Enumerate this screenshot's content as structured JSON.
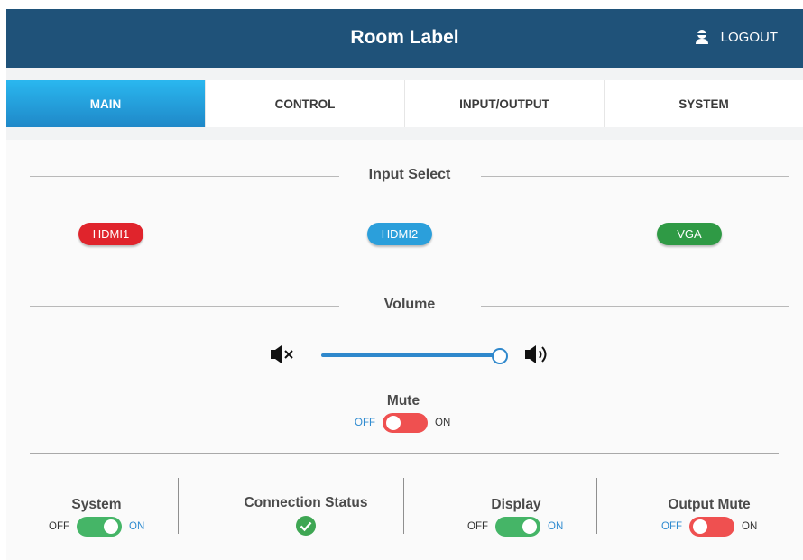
{
  "header": {
    "title": "Room Label",
    "logout_label": "LOGOUT"
  },
  "tabs": [
    {
      "label": "MAIN",
      "active": true
    },
    {
      "label": "CONTROL",
      "active": false
    },
    {
      "label": "INPUT/OUTPUT",
      "active": false
    },
    {
      "label": "SYSTEM",
      "active": false
    }
  ],
  "input_select": {
    "title": "Input Select",
    "inputs": [
      {
        "label": "HDMI1",
        "color": "#e0242c"
      },
      {
        "label": "HDMI2",
        "color": "#2b9fdb"
      },
      {
        "label": "VGA",
        "color": "#2f9a45"
      }
    ]
  },
  "volume": {
    "title": "Volume",
    "level": 1.0
  },
  "mute": {
    "title": "Mute",
    "off_label": "OFF",
    "on_label": "ON",
    "state": "on",
    "color": "#ef5050"
  },
  "status": {
    "system": {
      "title": "System",
      "off_label": "OFF",
      "on_label": "ON",
      "state": "on",
      "color": "#45b567"
    },
    "connection": {
      "title": "Connection Status",
      "icon": "check-circle-icon",
      "color": "#3ea653"
    },
    "display": {
      "title": "Display",
      "off_label": "OFF",
      "on_label": "ON",
      "state": "on",
      "color": "#45b567"
    },
    "output_mute": {
      "title": "Output Mute",
      "off_label": "OFF",
      "on_label": "ON",
      "state": "off",
      "color": "#ef5050"
    }
  },
  "colors": {
    "header": "#1f5279",
    "accent": "#2f88cc"
  }
}
